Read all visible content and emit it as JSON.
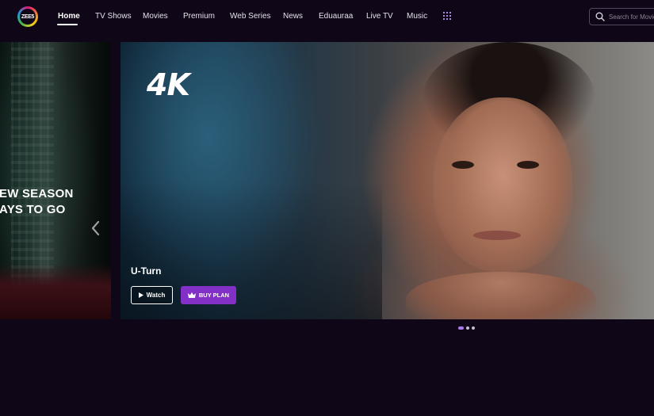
{
  "header": {
    "logo_text": "ZEE5",
    "nav": [
      {
        "label": "Home",
        "active": true
      },
      {
        "label": "TV Shows"
      },
      {
        "label": "Movies"
      },
      {
        "label": "Premium"
      },
      {
        "label": "Web Series"
      },
      {
        "label": "News"
      },
      {
        "label": "Eduauraa"
      },
      {
        "label": "Live TV"
      },
      {
        "label": "Music"
      }
    ],
    "apps_icon": "grid-icon",
    "search": {
      "placeholder": "Search for Movies, Shows, Channels etc.",
      "value": "",
      "icon": "search-icon"
    }
  },
  "carousel": {
    "prev_slide": {
      "text_line1": "NEW SEASON",
      "text_line2": "DAYS TO GO"
    },
    "prev_arrow_icon": "chevron-left-icon",
    "current_slide": {
      "badge": "4K",
      "title": "U-Turn",
      "watch_label": "Watch",
      "buy_label": "BUY PLAN",
      "buy_icon": "crown-icon"
    },
    "pagination": {
      "count": 3,
      "active_index": 0
    }
  },
  "colors": {
    "background": "#0f0617",
    "accent": "#8230c6",
    "active_dot": "#a979e6"
  }
}
